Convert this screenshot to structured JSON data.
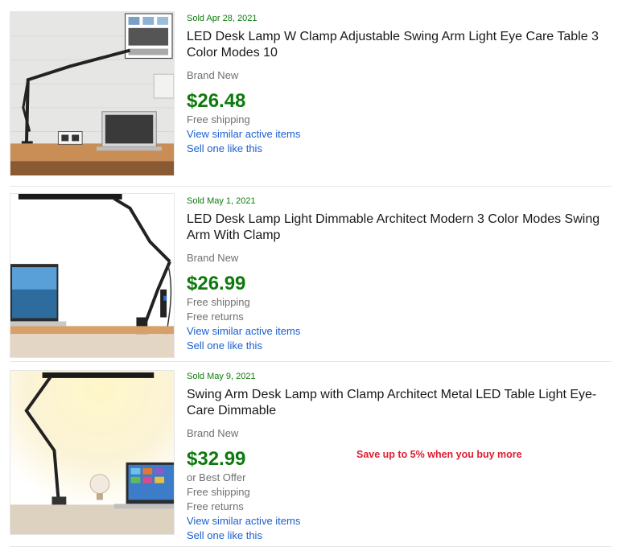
{
  "listings": [
    {
      "sold_date": "Sold Apr 28, 2021",
      "title": "LED Desk Lamp W Clamp Adjustable Swing Arm Light Eye Care Table 3 Color Modes 10",
      "condition": "Brand New",
      "price": "$26.48",
      "best_offer": "",
      "shipping": "Free shipping",
      "returns": "",
      "view_similar": "View similar active items",
      "sell_one": "Sell one like this",
      "promo": ""
    },
    {
      "sold_date": "Sold May 1, 2021",
      "title": "LED Desk Lamp Light Dimmable Architect Modern 3 Color Modes Swing Arm With Clamp",
      "condition": "Brand New",
      "price": "$26.99",
      "best_offer": "",
      "shipping": "Free shipping",
      "returns": "Free returns",
      "view_similar": "View similar active items",
      "sell_one": "Sell one like this",
      "promo": ""
    },
    {
      "sold_date": "Sold May 9, 2021",
      "title": "Swing Arm Desk Lamp with Clamp Architect Metal LED Table Light Eye-Care Dimmable",
      "condition": "Brand New",
      "price": "$32.99",
      "best_offer": "or Best Offer",
      "shipping": "Free shipping",
      "returns": "Free returns",
      "view_similar": "View similar active items",
      "sell_one": "Sell one like this",
      "promo": "Save up to 5% when you buy more"
    }
  ],
  "colors": {
    "sold_green": "#0e7a0e",
    "link_blue": "#1a5fd0",
    "promo_red": "#dd1e31",
    "meta_gray": "#707070"
  }
}
